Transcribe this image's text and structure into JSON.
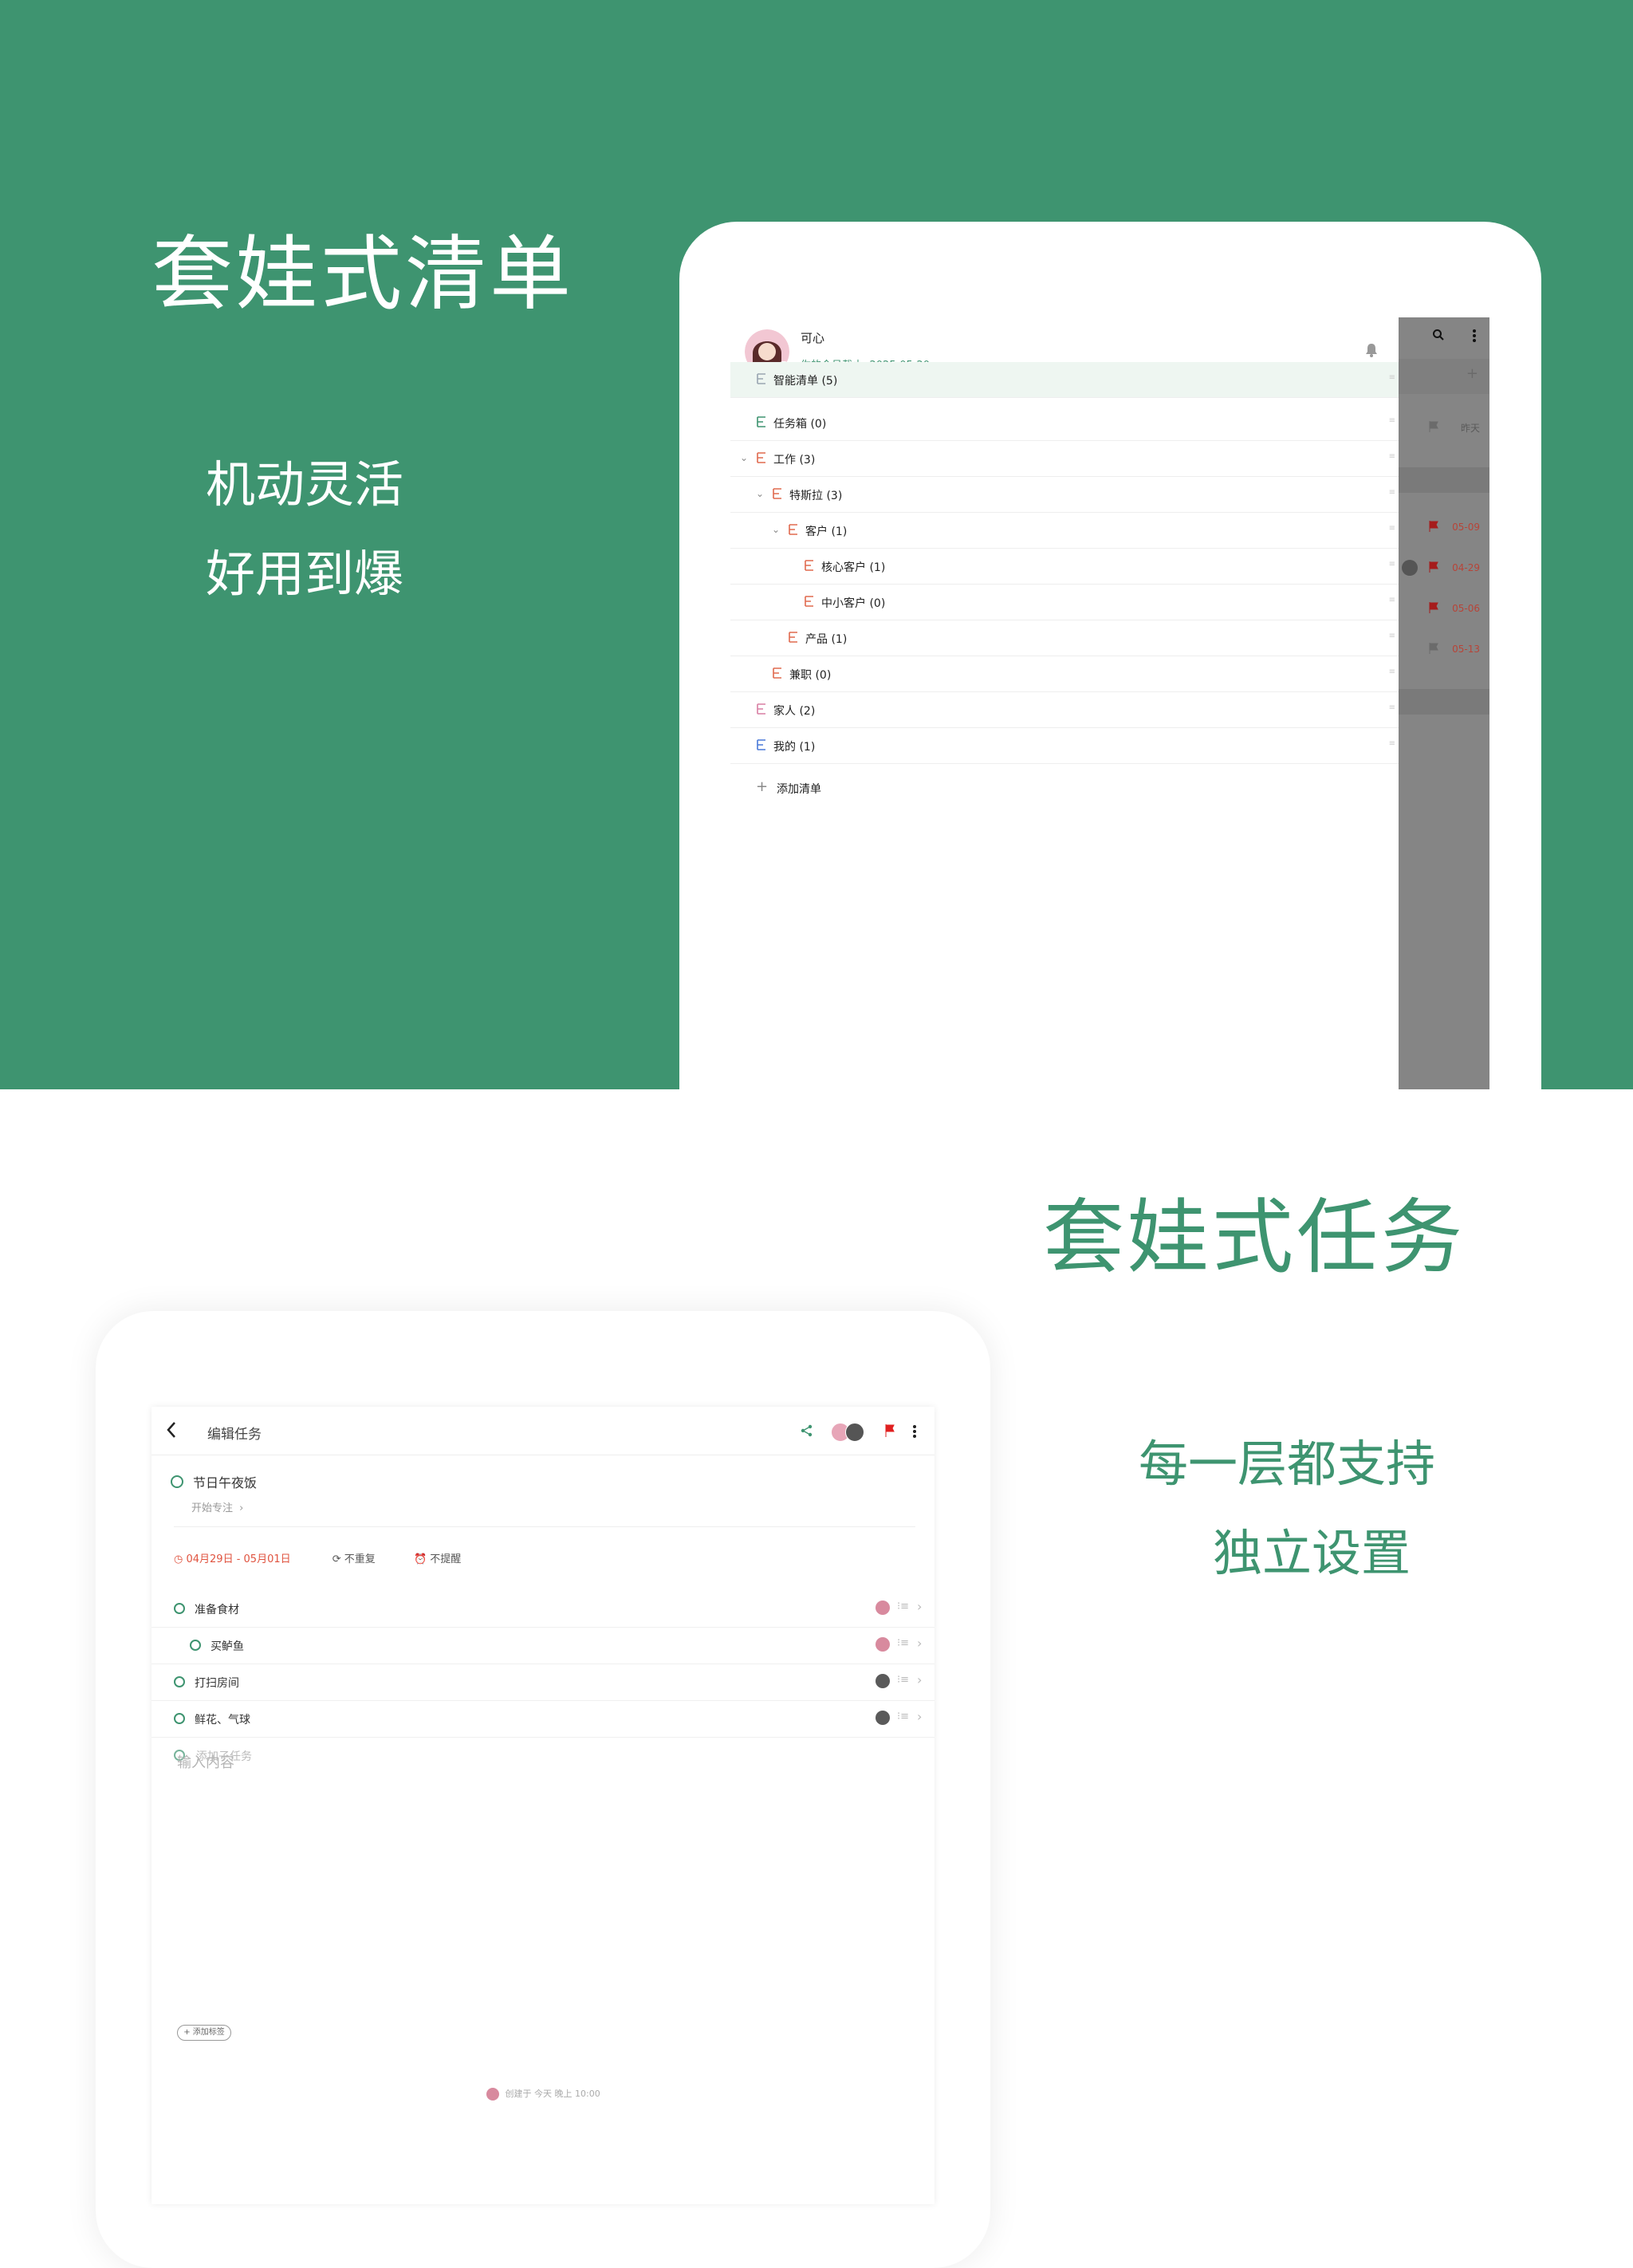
{
  "section1": {
    "headline": "套娃式清单",
    "tagline_lines": [
      "机动灵活",
      "好用到爆"
    ]
  },
  "sidebar": {
    "user_name": "可心",
    "membership": "你的会员截止: 2025-05-20",
    "lists": [
      {
        "label": "智能清单 (5)",
        "color": "#9aa5b1",
        "level": 0,
        "expanded": null,
        "selected": true
      },
      {
        "label": "任务箱 (0)",
        "color": "#3e9470",
        "level": 0,
        "expanded": null
      },
      {
        "label": "工作 (3)",
        "color": "#e06a4f",
        "level": 0,
        "expanded": true
      },
      {
        "label": "特斯拉 (3)",
        "color": "#e06a4f",
        "level": 1,
        "expanded": true
      },
      {
        "label": "客户 (1)",
        "color": "#e06a4f",
        "level": 2,
        "expanded": true
      },
      {
        "label": "核心客户 (1)",
        "color": "#e06a4f",
        "level": 3,
        "expanded": null
      },
      {
        "label": "中小客户 (0)",
        "color": "#e06a4f",
        "level": 3,
        "expanded": null
      },
      {
        "label": "产品 (1)",
        "color": "#e06a4f",
        "level": 2,
        "expanded": null
      },
      {
        "label": "兼职 (0)",
        "color": "#e06a4f",
        "level": 1,
        "expanded": null
      },
      {
        "label": "家人 (2)",
        "color": "#d97fa3",
        "level": 0,
        "expanded": null
      },
      {
        "label": "我的 (1)",
        "color": "#4a79d9",
        "level": 0,
        "expanded": null
      }
    ],
    "add_list_label": "添加清单"
  },
  "dimmed_panel": {
    "yesterday_label": "昨天",
    "dates": [
      "05-09",
      "04-29",
      "05-06",
      "05-13"
    ]
  },
  "section2": {
    "headline": "套娃式任务",
    "tagline_lines": [
      "每一层都支持",
      "独立设置"
    ]
  },
  "task_editor": {
    "header_title": "编辑任务",
    "task_title": "节日午夜饭",
    "focus_link": "开始专注",
    "date_range": "04月29日 - 05月01日",
    "repeat_label": "不重复",
    "reminder_label": "不提醒",
    "subtasks": [
      {
        "label": "准备食材",
        "indent": 0
      },
      {
        "label": "买鲈鱼",
        "indent": 1
      },
      {
        "label": "打扫房间",
        "indent": 0
      },
      {
        "label": "鲜花、气球",
        "indent": 0
      }
    ],
    "add_subtask_placeholder": "添加子任务",
    "content_placeholder": "输入内容",
    "add_tag_label": "+ 添加标签",
    "created_info": "创建于 今天 晚上 10:00"
  },
  "colors": {
    "brand_green": "#3e9470",
    "flag_red": "#e02020",
    "date_red": "#e0533f"
  }
}
